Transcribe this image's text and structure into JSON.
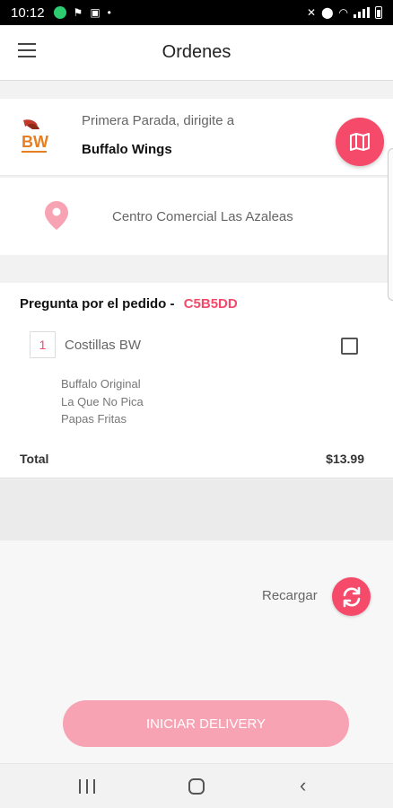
{
  "status_bar": {
    "time": "10:12"
  },
  "header": {
    "title": "Ordenes"
  },
  "stop": {
    "label": "Primera Parada, dirigite a",
    "name": "Buffalo Wings",
    "logo_text": "BW"
  },
  "address": {
    "text": "Centro Comercial Las Azaleas"
  },
  "order": {
    "heading": "Pregunta por el pedido -",
    "code": "C5B5DD",
    "items": [
      {
        "qty": "1",
        "name": "Costillas BW",
        "checked": false,
        "modifiers": [
          "Buffalo Original",
          "La Que No Pica",
          "Papas Fritas"
        ]
      }
    ],
    "total_label": "Total",
    "total_value": "$13.99"
  },
  "reload": {
    "label": "Recargar"
  },
  "actions": {
    "start_delivery": "INICIAR DELIVERY"
  },
  "colors": {
    "accent": "#f54a6a",
    "accent_disabled": "#f7a3b3"
  }
}
